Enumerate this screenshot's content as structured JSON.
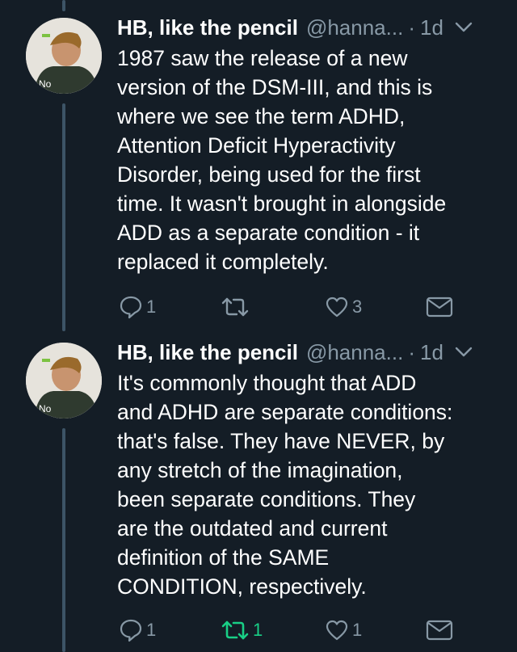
{
  "tweets": [
    {
      "name": "HB, like the pencil",
      "handle": "@hanna...",
      "separator": "·",
      "time": "1d",
      "text": "1987 saw the release of a new\nversion of the DSM-III, and this is\nwhere we see the term ADHD,\nAttention Deficit Hyperactivity\nDisorder, being used for the first\ntime. It wasn't brought in alongside\nADD as a separate condition - it\nreplaced it completely.",
      "replies": "1",
      "retweets": "",
      "likes": "3",
      "retweeted": false
    },
    {
      "name": "HB, like the pencil",
      "handle": "@hanna...",
      "separator": "·",
      "time": "1d",
      "text": "It's commonly thought that ADD\nand ADHD are separate conditions:\nthat's false. They have NEVER, by\nany stretch of the imagination,\nbeen separate conditions. They\nare the outdated and current\ndefinition of the SAME\nCONDITION, respectively.",
      "replies": "1",
      "retweets": "1",
      "likes": "1",
      "retweeted": true
    }
  ],
  "icons": {
    "reply": "reply-icon",
    "retweet": "retweet-icon",
    "like": "heart-icon",
    "message": "envelope-icon",
    "more": "chevron-down-icon"
  },
  "colors": {
    "background": "#141d26",
    "secondary_text": "#8899a6",
    "thread_line": "#3d5466",
    "retweet_active": "#19cf86"
  }
}
